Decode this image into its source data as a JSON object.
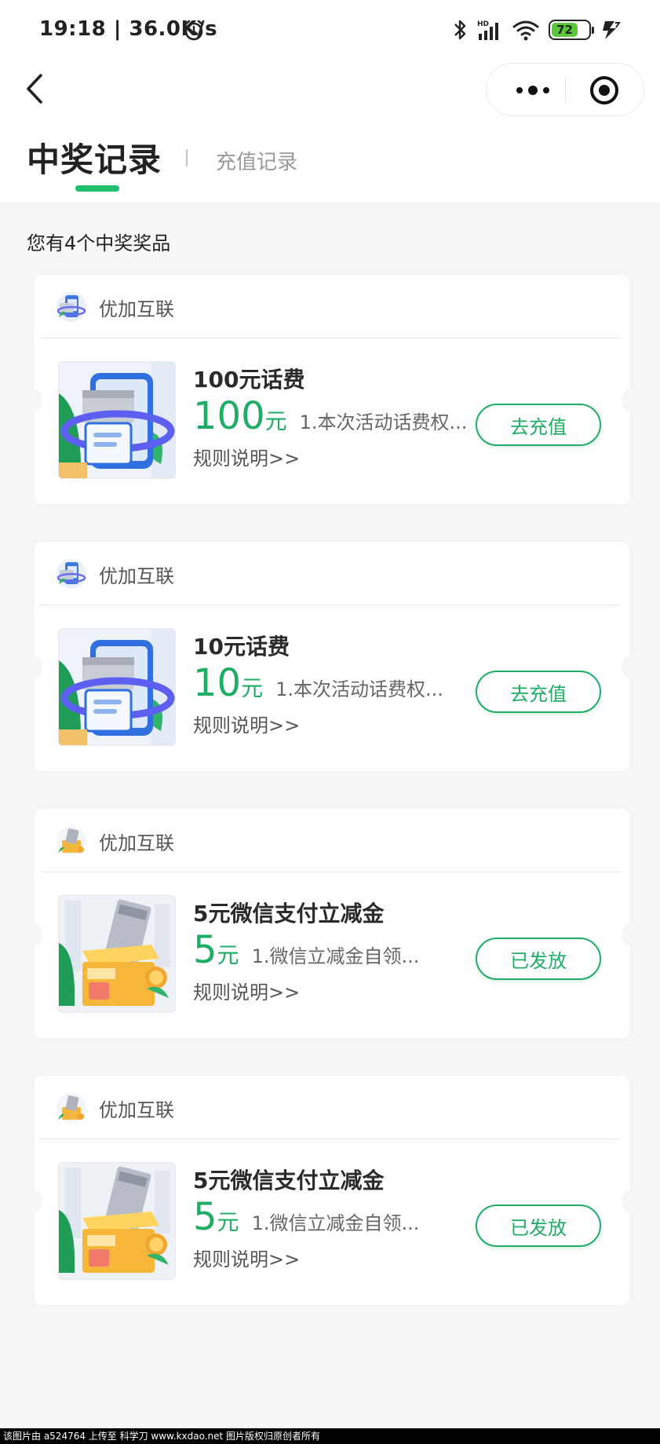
{
  "status_bar": {
    "time": "19:18 | 36.0K/s",
    "battery": "72",
    "icons": [
      "alarm-icon",
      "bluetooth-icon",
      "hd-signal-icon",
      "wifi-icon",
      "battery-icon",
      "charging-icon"
    ]
  },
  "nav": {
    "back_icon": "chevron-left-icon",
    "capsule_icons": [
      "more-dots-icon",
      "close-target-icon"
    ]
  },
  "tabs": {
    "active": "中奖记录",
    "inactive": "充值记录",
    "accent_color": "#1fbf6e"
  },
  "summary": "您有4个中奖奖品",
  "prizes": [
    {
      "merchant": "优加互联",
      "title": "100元话费",
      "value": "100",
      "unit": "元",
      "desc": "1.本次活动话费权...",
      "rules": "规则说明>>",
      "action": "去充值",
      "thumb": "phone-card-illustration"
    },
    {
      "merchant": "优加互联",
      "title": "10元话费",
      "value": "10",
      "unit": "元",
      "desc": "1.本次活动话费权...",
      "rules": "规则说明>>",
      "action": "去充值",
      "thumb": "phone-card-illustration"
    },
    {
      "merchant": "优加互联",
      "title": "5元微信支付立减金",
      "value": "5",
      "unit": "元",
      "desc": "1.微信立减金自领...",
      "rules": "规则说明>>",
      "action": "已发放",
      "thumb": "gift-box-card-illustration"
    },
    {
      "merchant": "优加互联",
      "title": "5元微信支付立减金",
      "value": "5",
      "unit": "元",
      "desc": "1.微信立减金自领...",
      "rules": "规则说明>>",
      "action": "已发放",
      "thumb": "gift-box-card-illustration"
    }
  ],
  "footer": "该图片由 a524764 上传至 科学刀 www.kxdao.net 图片版权归原创者所有"
}
